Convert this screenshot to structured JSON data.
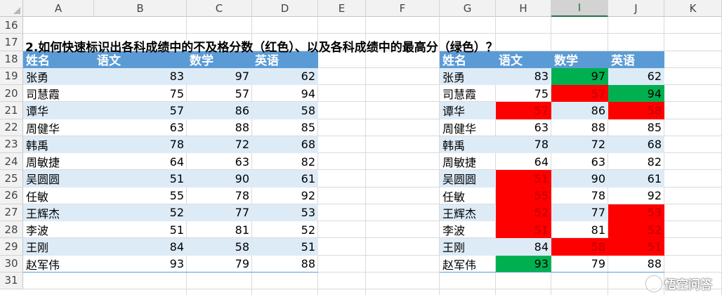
{
  "columns": [
    "A",
    "B",
    "C",
    "D",
    "E",
    "F",
    "G",
    "H",
    "I",
    "J",
    "K"
  ],
  "active_column": "I",
  "rows": [
    "16",
    "17",
    "18",
    "19",
    "20",
    "21",
    "22",
    "23",
    "24",
    "25",
    "26",
    "27",
    "28",
    "29",
    "30",
    "31"
  ],
  "title": "2.如何快速标识出各科成绩中的不及格分数（红色）、以及各科成绩中的最高分（绿色）？",
  "headers": {
    "name": "姓名",
    "chinese": "语文",
    "math": "数学",
    "english": "英语"
  },
  "students": [
    {
      "name": "张勇",
      "chinese": "83",
      "math": "97",
      "english": "62"
    },
    {
      "name": "司慧霞",
      "chinese": "75",
      "math": "57",
      "english": "94"
    },
    {
      "name": "谭华",
      "chinese": "57",
      "math": "86",
      "english": "58"
    },
    {
      "name": "周健华",
      "chinese": "63",
      "math": "88",
      "english": "85"
    },
    {
      "name": "韩禹",
      "chinese": "78",
      "math": "72",
      "english": "68"
    },
    {
      "name": "周敏捷",
      "chinese": "64",
      "math": "63",
      "english": "82"
    },
    {
      "name": "吴圆圆",
      "chinese": "51",
      "math": "90",
      "english": "61"
    },
    {
      "name": "任敏",
      "chinese": "55",
      "math": "78",
      "english": "92"
    },
    {
      "name": "王辉杰",
      "chinese": "52",
      "math": "77",
      "english": "53"
    },
    {
      "name": "李波",
      "chinese": "51",
      "math": "81",
      "english": "52"
    },
    {
      "name": "王刚",
      "chinese": "84",
      "math": "58",
      "english": "51"
    },
    {
      "name": "赵军伟",
      "chinese": "93",
      "math": "79",
      "english": "88"
    }
  ],
  "colors": {
    "header_blue": "#5b9bd5",
    "band": "#ddebf7",
    "fail_red": "#ff0000",
    "max_green": "#00b050"
  },
  "watermark": "悟空问答"
}
